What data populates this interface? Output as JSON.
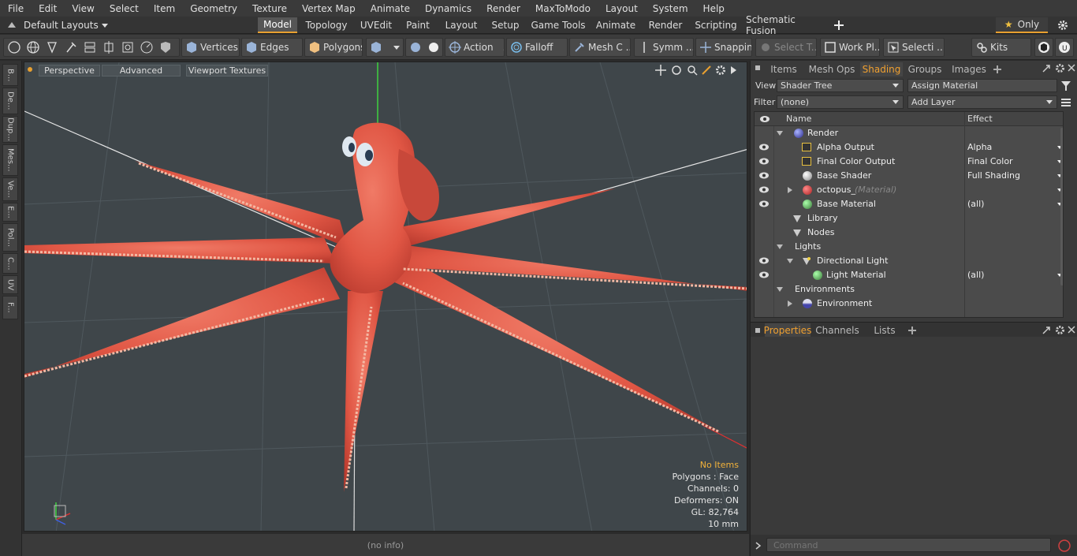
{
  "menu": [
    "File",
    "Edit",
    "View",
    "Select",
    "Item",
    "Geometry",
    "Texture",
    "Vertex Map",
    "Animate",
    "Dynamics",
    "Render",
    "MaxToModo",
    "Layout",
    "System",
    "Help"
  ],
  "layout_selector": "Default Layouts",
  "top_tabs": [
    "Model",
    "Topology",
    "UVEdit",
    "Paint",
    "Layout",
    "Setup",
    "Game Tools",
    "Animate",
    "Render",
    "Scripting",
    "Schematic Fusion"
  ],
  "active_top_tab": "Model",
  "only_label": "Only",
  "toolbar": {
    "vertices": "Vertices",
    "edges": "Edges",
    "polygons": "Polygons",
    "action": "Action",
    "falloff": "Falloff",
    "mesh": "Mesh C ...",
    "symm": "Symm ...",
    "snapping": "Snapping",
    "select_t": "Select T...",
    "work_pl": "Work Pl...",
    "selecti": "Selecti ...",
    "kits": "Kits"
  },
  "left_tabs": [
    "B...",
    "De...",
    "Dup...",
    "Mes...",
    "Ve...",
    "E...",
    "Pol...",
    "C...",
    "UV",
    "F..."
  ],
  "viewport": {
    "tabs": [
      "Perspective",
      "Advanced",
      "Viewport Textures"
    ],
    "stats": {
      "items": "No Items",
      "polygons": "Polygons : Face",
      "channels": "Channels: 0",
      "deformers": "Deformers: ON",
      "gl": "GL: 82,764",
      "unit": "10 mm"
    },
    "item_color": "#f2b23a"
  },
  "status": "(no info)",
  "panel": {
    "tabs": [
      "Items",
      "Mesh Ops",
      "Shading",
      "Groups",
      "Images"
    ],
    "active_tab": "Shading",
    "view_label": "View",
    "view_value": "Shader Tree",
    "assign_material": "Assign Material",
    "filter_label": "Filter",
    "filter_value": "(none)",
    "add_layer": "Add Layer",
    "col_name": "Name",
    "col_effect": "Effect",
    "rows": [
      {
        "name": "Render",
        "effect": ""
      },
      {
        "name": "Alpha Output",
        "effect": "Alpha"
      },
      {
        "name": "Final Color Output",
        "effect": "Final Color"
      },
      {
        "name": "Base Shader",
        "effect": "Full Shading"
      },
      {
        "name": "octopus_",
        "sub": "(Material)",
        "effect": ""
      },
      {
        "name": "Base Material",
        "effect": "(all)"
      },
      {
        "name": "Library",
        "effect": ""
      },
      {
        "name": "Nodes",
        "effect": ""
      },
      {
        "name": "Lights",
        "effect": ""
      },
      {
        "name": "Directional Light",
        "effect": ""
      },
      {
        "name": "Light Material",
        "effect": "(all)"
      },
      {
        "name": "Environments",
        "effect": ""
      },
      {
        "name": "Environment",
        "effect": ""
      }
    ],
    "bottom_tabs": [
      "Properties",
      "Channels",
      "Lists"
    ],
    "bottom_active": "Properties",
    "command_placeholder": "Command"
  },
  "accent": "#e8a030"
}
